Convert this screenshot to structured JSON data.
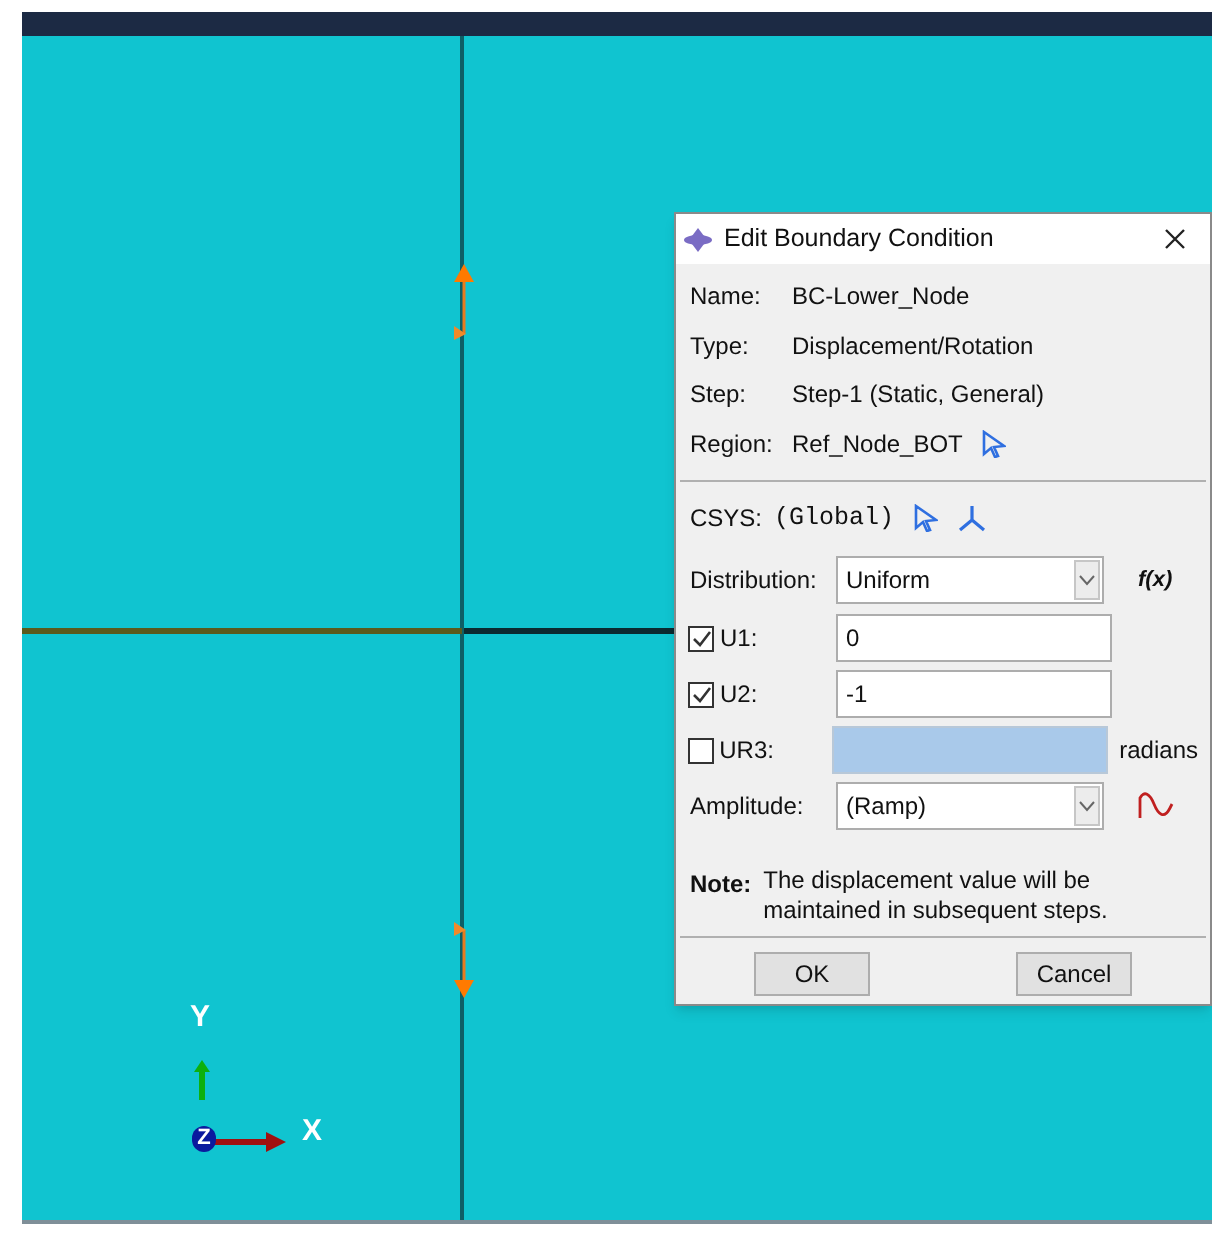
{
  "viewport": {
    "triad": {
      "y_label": "Y",
      "x_label": "X",
      "z_label": "Z"
    }
  },
  "dialog": {
    "title": "Edit Boundary Condition",
    "info": [
      {
        "kind": "text",
        "label": "Name:",
        "value": "BC-Lower_Node"
      },
      {
        "kind": "text",
        "label": "Type:",
        "value": "Displacement/Rotation"
      },
      {
        "kind": "text",
        "label": "Step:",
        "value": "Step-1 (Static, General)"
      },
      {
        "kind": "pick",
        "label": "Region:",
        "value": "Ref_Node_BOT"
      }
    ],
    "csys": {
      "label": "CSYS:",
      "value": "(Global)"
    },
    "distribution": {
      "label": "Distribution:",
      "value": "Uniform",
      "function_label": "f(x)"
    },
    "dofs": [
      {
        "label": "U1:",
        "checked": true,
        "value": "0"
      },
      {
        "label": "U2:",
        "checked": true,
        "value": "-1"
      },
      {
        "label": "UR3:",
        "checked": false,
        "unit": "radians"
      }
    ],
    "amplitude": {
      "label": "Amplitude:",
      "value": "(Ramp)"
    },
    "note": {
      "label": "Note:",
      "text": "The displacement value will be maintained in subsequent steps."
    },
    "buttons": [
      "OK",
      "Cancel"
    ]
  }
}
